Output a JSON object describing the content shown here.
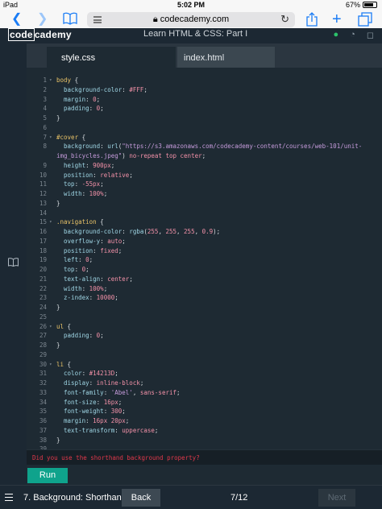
{
  "status_bar": {
    "device": "iPad",
    "time": "5:02 PM",
    "battery": "67%"
  },
  "browser": {
    "url": "codecademy.com"
  },
  "header": {
    "logo_left": "code",
    "logo_right": "cademy",
    "lesson_title": "Learn HTML & CSS: Part I"
  },
  "tabs": [
    {
      "label": "style.css"
    },
    {
      "label": "index.html"
    }
  ],
  "editor": {
    "lines": [
      {
        "n": "1",
        "fold": "▾",
        "tokens": [
          [
            "sel",
            "body"
          ],
          [
            "txt",
            " {"
          ]
        ]
      },
      {
        "n": "2",
        "fold": "",
        "tokens": [
          [
            "txt",
            "  "
          ],
          [
            "prop",
            "background-color"
          ],
          [
            "txt",
            ": "
          ],
          [
            "val",
            "#FFF"
          ],
          [
            "txt",
            ";"
          ]
        ]
      },
      {
        "n": "3",
        "fold": "",
        "tokens": [
          [
            "txt",
            "  "
          ],
          [
            "prop",
            "margin"
          ],
          [
            "txt",
            ": "
          ],
          [
            "val",
            "0"
          ],
          [
            "txt",
            ";"
          ]
        ]
      },
      {
        "n": "4",
        "fold": "",
        "tokens": [
          [
            "txt",
            "  "
          ],
          [
            "prop",
            "padding"
          ],
          [
            "txt",
            ": "
          ],
          [
            "val",
            "0"
          ],
          [
            "txt",
            ";"
          ]
        ]
      },
      {
        "n": "5",
        "fold": "",
        "tokens": [
          [
            "txt",
            "}"
          ]
        ]
      },
      {
        "n": "6",
        "fold": "",
        "tokens": []
      },
      {
        "n": "7",
        "fold": "▾",
        "tokens": [
          [
            "sel",
            "#cover"
          ],
          [
            "txt",
            " {"
          ]
        ]
      },
      {
        "n": "8",
        "fold": "",
        "tokens": [
          [
            "txt",
            "  "
          ],
          [
            "prop",
            "background"
          ],
          [
            "txt",
            ": "
          ],
          [
            "prop",
            "url"
          ],
          [
            "txt",
            "("
          ],
          [
            "str",
            "\"https://s3.amazonaws.com/codecademy-content/courses/web-101/unit-"
          ]
        ]
      },
      {
        "n": "",
        "fold": "",
        "tokens": [
          [
            "str",
            "img_bicycles.jpeg\""
          ],
          [
            "txt",
            ") "
          ],
          [
            "val",
            "no-repeat top center"
          ],
          [
            "txt",
            ";"
          ]
        ]
      },
      {
        "n": "9",
        "fold": "",
        "tokens": [
          [
            "txt",
            "  "
          ],
          [
            "prop",
            "height"
          ],
          [
            "txt",
            ": "
          ],
          [
            "val",
            "900px"
          ],
          [
            "txt",
            ";"
          ]
        ]
      },
      {
        "n": "10",
        "fold": "",
        "tokens": [
          [
            "txt",
            "  "
          ],
          [
            "prop",
            "position"
          ],
          [
            "txt",
            ": "
          ],
          [
            "val",
            "relative"
          ],
          [
            "txt",
            ";"
          ]
        ]
      },
      {
        "n": "11",
        "fold": "",
        "tokens": [
          [
            "txt",
            "  "
          ],
          [
            "prop",
            "top"
          ],
          [
            "txt",
            ": "
          ],
          [
            "val",
            "-55px"
          ],
          [
            "txt",
            ";"
          ]
        ]
      },
      {
        "n": "12",
        "fold": "",
        "tokens": [
          [
            "txt",
            "  "
          ],
          [
            "prop",
            "width"
          ],
          [
            "txt",
            ": "
          ],
          [
            "val",
            "100%"
          ],
          [
            "txt",
            ";"
          ]
        ]
      },
      {
        "n": "13",
        "fold": "",
        "tokens": [
          [
            "txt",
            "}"
          ]
        ]
      },
      {
        "n": "14",
        "fold": "",
        "tokens": []
      },
      {
        "n": "15",
        "fold": "▾",
        "tokens": [
          [
            "sel",
            ".navigation"
          ],
          [
            "txt",
            " {"
          ]
        ]
      },
      {
        "n": "16",
        "fold": "",
        "tokens": [
          [
            "txt",
            "  "
          ],
          [
            "prop",
            "background-color"
          ],
          [
            "txt",
            ": "
          ],
          [
            "prop",
            "rgba"
          ],
          [
            "txt",
            "("
          ],
          [
            "val",
            "255"
          ],
          [
            "txt",
            ", "
          ],
          [
            "val",
            "255"
          ],
          [
            "txt",
            ", "
          ],
          [
            "val",
            "255"
          ],
          [
            "txt",
            ", "
          ],
          [
            "val",
            "0.9"
          ],
          [
            "txt",
            ");"
          ]
        ]
      },
      {
        "n": "17",
        "fold": "",
        "tokens": [
          [
            "txt",
            "  "
          ],
          [
            "prop",
            "overflow-y"
          ],
          [
            "txt",
            ": "
          ],
          [
            "val",
            "auto"
          ],
          [
            "txt",
            ";"
          ]
        ]
      },
      {
        "n": "18",
        "fold": "",
        "tokens": [
          [
            "txt",
            "  "
          ],
          [
            "prop",
            "position"
          ],
          [
            "txt",
            ": "
          ],
          [
            "val",
            "fixed"
          ],
          [
            "txt",
            ";"
          ]
        ]
      },
      {
        "n": "19",
        "fold": "",
        "tokens": [
          [
            "txt",
            "  "
          ],
          [
            "prop",
            "left"
          ],
          [
            "txt",
            ": "
          ],
          [
            "val",
            "0"
          ],
          [
            "txt",
            ";"
          ]
        ]
      },
      {
        "n": "20",
        "fold": "",
        "tokens": [
          [
            "txt",
            "  "
          ],
          [
            "prop",
            "top"
          ],
          [
            "txt",
            ": "
          ],
          [
            "val",
            "0"
          ],
          [
            "txt",
            ";"
          ]
        ]
      },
      {
        "n": "21",
        "fold": "",
        "tokens": [
          [
            "txt",
            "  "
          ],
          [
            "prop",
            "text-align"
          ],
          [
            "txt",
            ": "
          ],
          [
            "val",
            "center"
          ],
          [
            "txt",
            ";"
          ]
        ]
      },
      {
        "n": "22",
        "fold": "",
        "tokens": [
          [
            "txt",
            "  "
          ],
          [
            "prop",
            "width"
          ],
          [
            "txt",
            ": "
          ],
          [
            "val",
            "100%"
          ],
          [
            "txt",
            ";"
          ]
        ]
      },
      {
        "n": "23",
        "fold": "",
        "tokens": [
          [
            "txt",
            "  "
          ],
          [
            "prop",
            "z-index"
          ],
          [
            "txt",
            ": "
          ],
          [
            "val",
            "10000"
          ],
          [
            "txt",
            ";"
          ]
        ]
      },
      {
        "n": "24",
        "fold": "",
        "tokens": [
          [
            "txt",
            "}"
          ]
        ]
      },
      {
        "n": "25",
        "fold": "",
        "tokens": []
      },
      {
        "n": "26",
        "fold": "▾",
        "tokens": [
          [
            "sel",
            "ul"
          ],
          [
            "txt",
            " {"
          ]
        ]
      },
      {
        "n": "27",
        "fold": "",
        "tokens": [
          [
            "txt",
            "  "
          ],
          [
            "prop",
            "padding"
          ],
          [
            "txt",
            ": "
          ],
          [
            "val",
            "0"
          ],
          [
            "txt",
            ";"
          ]
        ]
      },
      {
        "n": "28",
        "fold": "",
        "tokens": [
          [
            "txt",
            "}"
          ]
        ]
      },
      {
        "n": "29",
        "fold": "",
        "tokens": []
      },
      {
        "n": "30",
        "fold": "▾",
        "tokens": [
          [
            "sel",
            "li"
          ],
          [
            "txt",
            " {"
          ]
        ]
      },
      {
        "n": "31",
        "fold": "",
        "tokens": [
          [
            "txt",
            "  "
          ],
          [
            "prop",
            "color"
          ],
          [
            "txt",
            ": "
          ],
          [
            "val",
            "#14213D"
          ],
          [
            "txt",
            ";"
          ]
        ]
      },
      {
        "n": "32",
        "fold": "",
        "tokens": [
          [
            "txt",
            "  "
          ],
          [
            "prop",
            "display"
          ],
          [
            "txt",
            ": "
          ],
          [
            "val",
            "inline-block"
          ],
          [
            "txt",
            ";"
          ]
        ]
      },
      {
        "n": "33",
        "fold": "",
        "tokens": [
          [
            "txt",
            "  "
          ],
          [
            "prop",
            "font-family"
          ],
          [
            "txt",
            ": "
          ],
          [
            "str",
            "'Abel'"
          ],
          [
            "txt",
            ", "
          ],
          [
            "val",
            "sans-serif"
          ],
          [
            "txt",
            ";"
          ]
        ]
      },
      {
        "n": "34",
        "fold": "",
        "tokens": [
          [
            "txt",
            "  "
          ],
          [
            "prop",
            "font-size"
          ],
          [
            "txt",
            ": "
          ],
          [
            "val",
            "16px"
          ],
          [
            "txt",
            ";"
          ]
        ]
      },
      {
        "n": "35",
        "fold": "",
        "tokens": [
          [
            "txt",
            "  "
          ],
          [
            "prop",
            "font-weight"
          ],
          [
            "txt",
            ": "
          ],
          [
            "val",
            "300"
          ],
          [
            "txt",
            ";"
          ]
        ]
      },
      {
        "n": "36",
        "fold": "",
        "tokens": [
          [
            "txt",
            "  "
          ],
          [
            "prop",
            "margin"
          ],
          [
            "txt",
            ": "
          ],
          [
            "val",
            "16px 20px"
          ],
          [
            "txt",
            ";"
          ]
        ]
      },
      {
        "n": "37",
        "fold": "",
        "tokens": [
          [
            "txt",
            "  "
          ],
          [
            "prop",
            "text-transform"
          ],
          [
            "txt",
            ": "
          ],
          [
            "val",
            "uppercase"
          ],
          [
            "txt",
            ";"
          ]
        ]
      },
      {
        "n": "38",
        "fold": "",
        "tokens": [
          [
            "txt",
            "}"
          ]
        ]
      },
      {
        "n": "39",
        "fold": "",
        "tokens": []
      }
    ]
  },
  "error_message": "Did you use the shorthand background property?",
  "run_label": "Run",
  "footer": {
    "lesson": "7. Background: Shorthand",
    "back_label": "Back",
    "page": "7/12",
    "next_label": "Next"
  },
  "colors": {
    "run_button": "#0fa38c",
    "error_text": "#e1384b",
    "selector": "#e8c267",
    "property": "#9fd6e5",
    "value": "#f391a8",
    "string": "#c59bdb"
  },
  "icons": {
    "nav": [
      "back-icon",
      "forward-icon",
      "bookmarks-icon",
      "reader-icon",
      "lock-icon",
      "reload-icon",
      "share-icon",
      "add-tab-icon",
      "tabs-icon"
    ],
    "header": [
      "status-dot-icon",
      "profile-icon",
      "help-icon"
    ],
    "side": "book-icon",
    "footer": "menu-icon"
  }
}
